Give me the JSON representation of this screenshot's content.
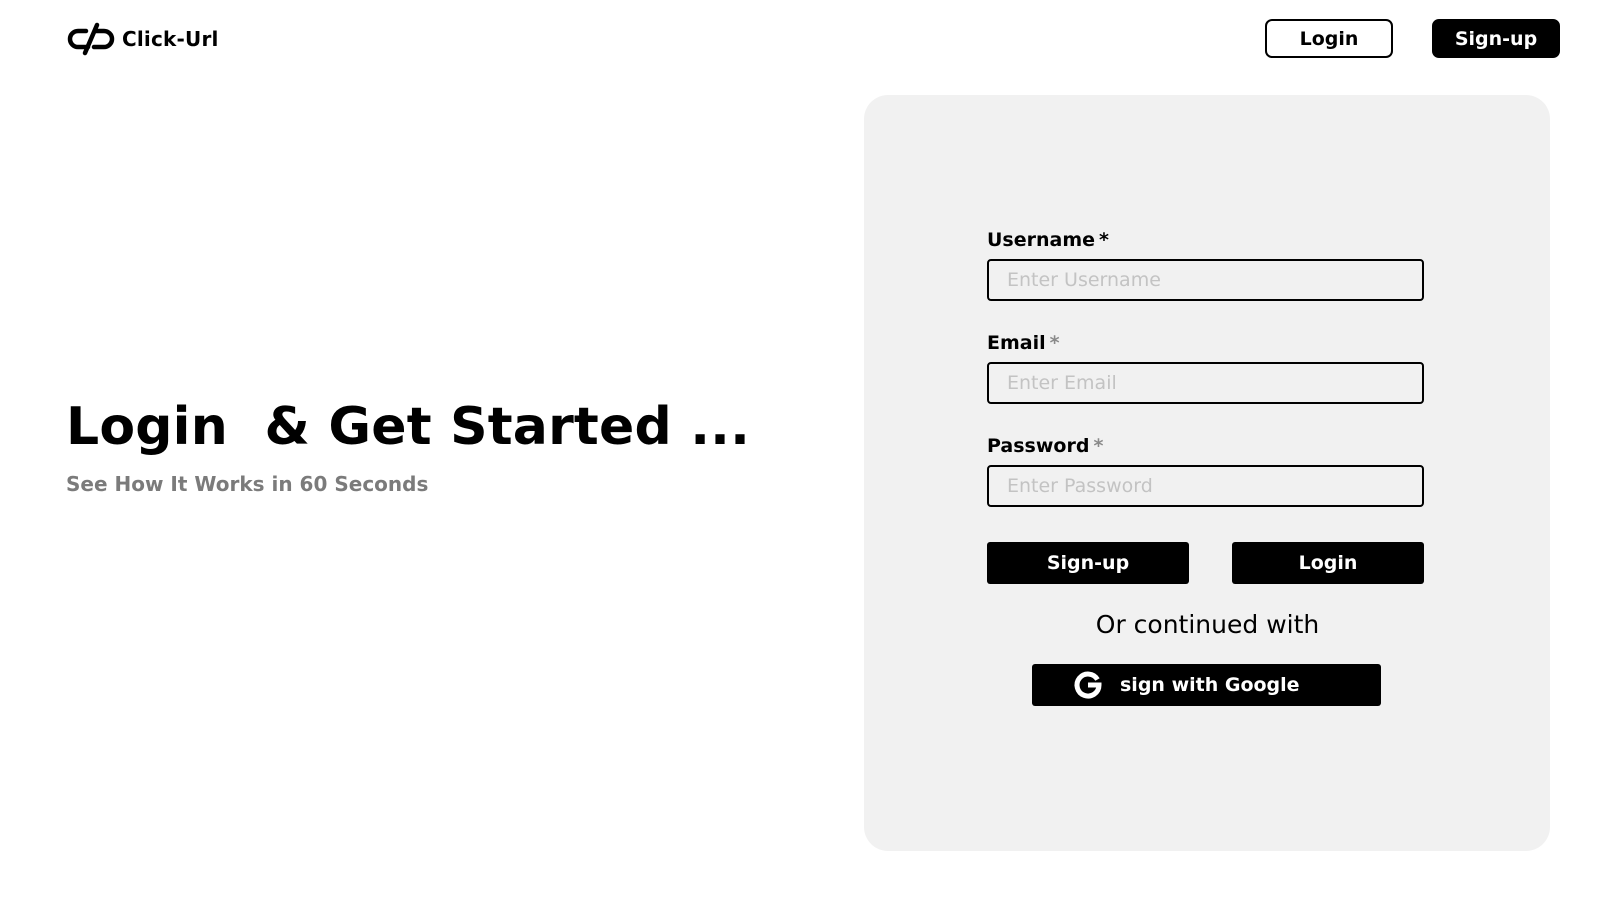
{
  "brand": {
    "name": "Click-Url",
    "logo_icon": "link-break-icon"
  },
  "header": {
    "login_label": "Login",
    "signup_label": "Sign-up"
  },
  "hero": {
    "title": "Login  & Get Started ...",
    "subtitle": "See How It Works in 60 Seconds"
  },
  "form": {
    "username": {
      "label": "Username",
      "required_mark": "*",
      "placeholder": "Enter Username",
      "value": ""
    },
    "email": {
      "label": "Email",
      "required_mark": "*",
      "placeholder": "Enter Email",
      "value": ""
    },
    "password": {
      "label": "Password",
      "required_mark": "*",
      "placeholder": "Enter Password",
      "value": ""
    },
    "signup_label": "Sign-up",
    "login_label": "Login",
    "divider_text": "Or continued with",
    "google_label": "sign with Google",
    "google_icon": "google-icon"
  },
  "colors": {
    "primary": "#000000",
    "panel_background": "#f1f1f1",
    "subtitle": "#7b7b7b",
    "placeholder": "#c3c3c3"
  }
}
